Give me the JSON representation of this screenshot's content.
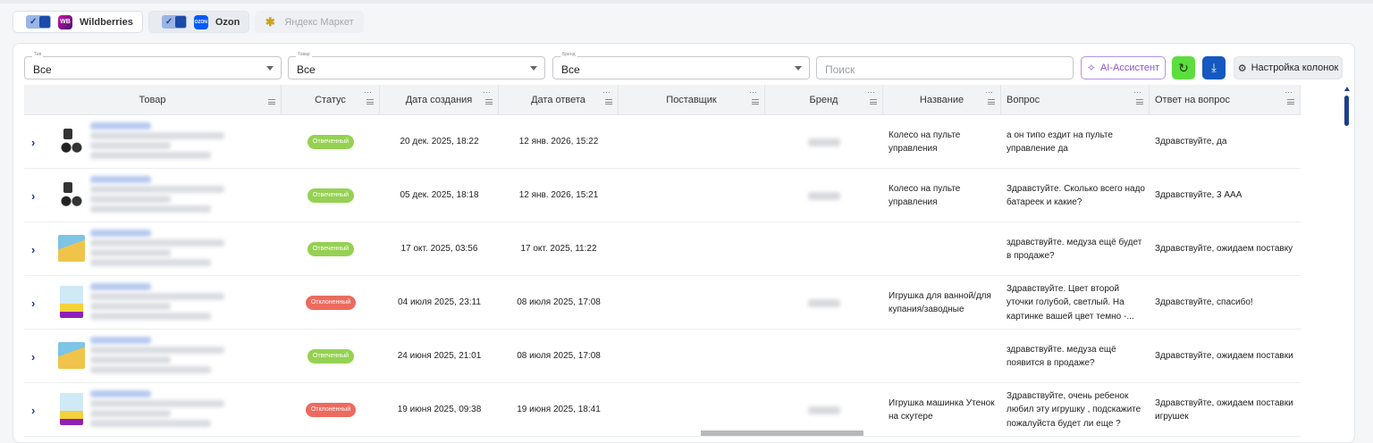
{
  "marketplaces": [
    {
      "name": "Wildberries",
      "logo_text": "WB",
      "enabled": true,
      "active": false
    },
    {
      "name": "Ozon",
      "logo_text": "OZON",
      "enabled": true,
      "active": true
    },
    {
      "name": "Яндекс Маркет",
      "logo_text": "Y",
      "enabled": false,
      "active": false
    }
  ],
  "filters": {
    "type": {
      "label": "Тип",
      "value": "Все"
    },
    "product": {
      "label": "Товар",
      "value": "Все"
    },
    "brand": {
      "label": "Бренд",
      "value": "Все"
    },
    "search_placeholder": "Поиск"
  },
  "toolbar": {
    "ai_label": "AI-Ассистент",
    "columns_label": "Настройка колонок",
    "refresh_icon": "refresh-icon",
    "download_icon": "download-icon"
  },
  "columns": [
    "Товар",
    "Статус",
    "Дата создания",
    "Дата ответа",
    "Поставщик",
    "Бренд",
    "Название",
    "Вопрос",
    "Ответ на вопрос"
  ],
  "colors": {
    "accent": "#1d3f8a",
    "answered": "#95d152",
    "rejected": "#ec6b5e",
    "ai": "#8a55d9",
    "refresh": "#5cde3e",
    "download": "#1558c0"
  },
  "rows": [
    {
      "status": "Отвеченный",
      "status_type": "ok",
      "created": "20 дек. 2025, 18:22",
      "answered": "12 янв. 2026, 15:22",
      "name": "Колесо на пульте управления",
      "question": "а он типо ездит на пульте управление да",
      "answer": "Здравствуйте, да",
      "thumb": "t1",
      "brand_hidden": true
    },
    {
      "status": "Отвеченный",
      "status_type": "ok",
      "created": "05 дек. 2025, 18:18",
      "answered": "12 янв. 2026, 15:21",
      "name": "Колесо на пульте управления",
      "question": "Здравстуйте. Сколько всего надо батареек и какие?",
      "answer": "Здравствуйте, 3 ААА",
      "thumb": "t1",
      "brand_hidden": true
    },
    {
      "status": "Отвеченный",
      "status_type": "ok",
      "created": "17 окт. 2025, 03:56",
      "answered": "17 окт. 2025, 11:22",
      "name": "",
      "question": "здравствуйте. медуза ещё будет в продаже?",
      "answer": "Здравствуйте, ожидаем поставку",
      "thumb": "t2",
      "brand_hidden": false
    },
    {
      "status": "Отклоненный",
      "status_type": "rej",
      "created": "04 июля 2025, 23:11",
      "answered": "08 июля 2025, 17:08",
      "name": "Игрушка для ванной/для купания/заводные",
      "question": "Здравствуйте. Цвет второй уточки голубой, светлый. На картинке вашей цвет темно -...",
      "answer": "Здравствуйте, спасибо!",
      "thumb": "t3",
      "brand_hidden": true
    },
    {
      "status": "Отвеченный",
      "status_type": "ok",
      "created": "24 июня 2025, 21:01",
      "answered": "08 июля 2025, 17:08",
      "name": "",
      "question": "здравствуйте. медуза ещё появится в продаже?",
      "answer": "Здравствуйте, ожидаем поставки",
      "thumb": "t2",
      "brand_hidden": false
    },
    {
      "status": "Отклоненный",
      "status_type": "rej",
      "created": "19 июня 2025, 09:38",
      "answered": "19 июня 2025, 18:41",
      "name": "Игрушка машинка Утенок на скутере",
      "question": "Здравствуйте, очень ребенок любил эту игрушку , подскажите пожалуйста будет ли еще ?",
      "answer": "Здравствуйте, ожидаем поставки игрушек",
      "thumb": "t3",
      "brand_hidden": true
    }
  ]
}
